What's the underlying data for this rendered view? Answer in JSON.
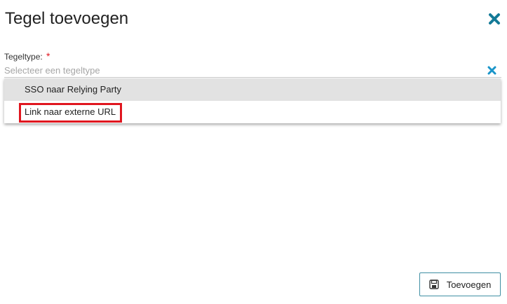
{
  "dialog": {
    "title": "Tegel toevoegen",
    "close_icon": "close-icon",
    "accent_color": "#137a97"
  },
  "field": {
    "label": "Tegeltype:",
    "required_marker": "*",
    "placeholder": "Selecteer een tegeltype",
    "clear_icon": "clear-icon"
  },
  "dropdown": {
    "options": [
      {
        "label": "SSO naar Relying Party",
        "state": "hovered"
      },
      {
        "label": "Link naar externe URL",
        "state": "highlighted"
      }
    ],
    "highlight_color": "#e0161f"
  },
  "footer": {
    "submit_label": "Toevoegen",
    "submit_icon": "save-icon"
  }
}
